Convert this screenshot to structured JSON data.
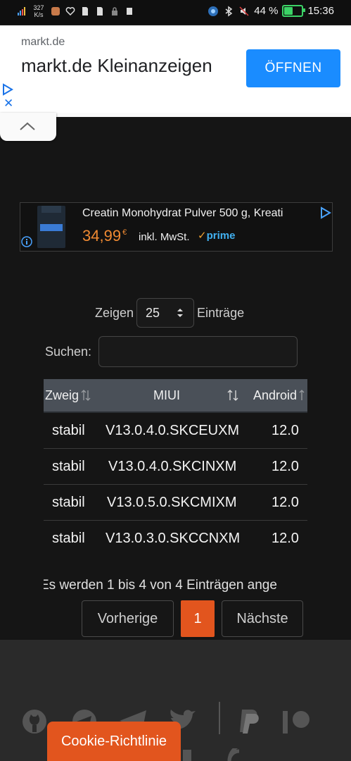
{
  "status_bar": {
    "speed_value": "327",
    "speed_unit": "K/s",
    "battery_percent": "44 %",
    "time": "15:36"
  },
  "ad_banner": {
    "domain": "markt.de",
    "title": "markt.de Kleinanzeigen",
    "open_button": "ÖFFNEN"
  },
  "amazon_ad": {
    "product_title": "Creatin Monohydrat Pulver 500 g, Kreati",
    "price": "34,99",
    "currency": "€",
    "vat_note": "inkl. MwSt.",
    "prime_label": "prime"
  },
  "table_controls": {
    "show_label": "Zeigen",
    "page_size": "25",
    "entries_label": "Einträge",
    "search_label": "Suchen:",
    "search_value": ""
  },
  "table": {
    "columns": [
      "Zweig",
      "MIUI",
      "Android"
    ],
    "rows": [
      [
        "stabil",
        "V13.0.4.0.SKCEUXM",
        "12.0"
      ],
      [
        "stabil",
        "V13.0.4.0.SKCINXM",
        "12.0"
      ],
      [
        "stabil",
        "V13.0.5.0.SKCMIXM",
        "12.0"
      ],
      [
        "stabil",
        "V13.0.3.0.SKCCNXM",
        "12.0"
      ]
    ]
  },
  "table_info": "Es werden 1 bis 4 von 4 Einträgen ange",
  "pagination": {
    "previous": "Vorherige",
    "current": "1",
    "next": "Nächste"
  },
  "footer": {
    "cookie_button": "Cookie-Richtlinie"
  },
  "colors": {
    "accent": "#e2551e",
    "ad_button": "#1a8cff",
    "price": "#f08a32"
  }
}
